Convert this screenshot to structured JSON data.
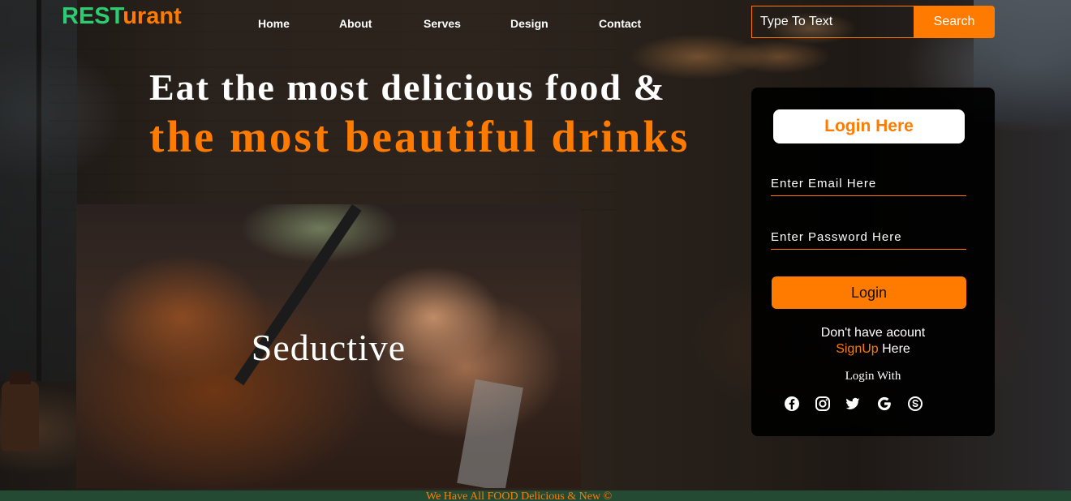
{
  "logo": {
    "part1": "REST",
    "part2": "urant"
  },
  "nav": [
    "Home",
    "About",
    "Serves",
    "Design",
    "Contact"
  ],
  "search": {
    "placeholder": "Type To Text",
    "button": "Search"
  },
  "hero": {
    "line1": "Eat the most delicious food &",
    "line2": "the most beautiful drinks"
  },
  "video": {
    "caption": "Seductive"
  },
  "login": {
    "title": "Login Here",
    "email_placeholder": "Enter Email Here",
    "password_placeholder": "Enter Password Here",
    "button": "Login",
    "no_account": "Don't have acount",
    "signup_link": "SignUp",
    "signup_suffix": " Here",
    "login_with": "Login With",
    "social_icons": [
      "facebook-icon",
      "instagram-icon",
      "twitter-icon",
      "google-icon",
      "skype-icon"
    ]
  },
  "footer": {
    "text": "We Have All FOOD Delicious & New ©"
  },
  "colors": {
    "accent": "#ff7b00",
    "logo_green": "#2ecc71",
    "footer_bg": "#244a33",
    "panel_bg": "#000000"
  }
}
